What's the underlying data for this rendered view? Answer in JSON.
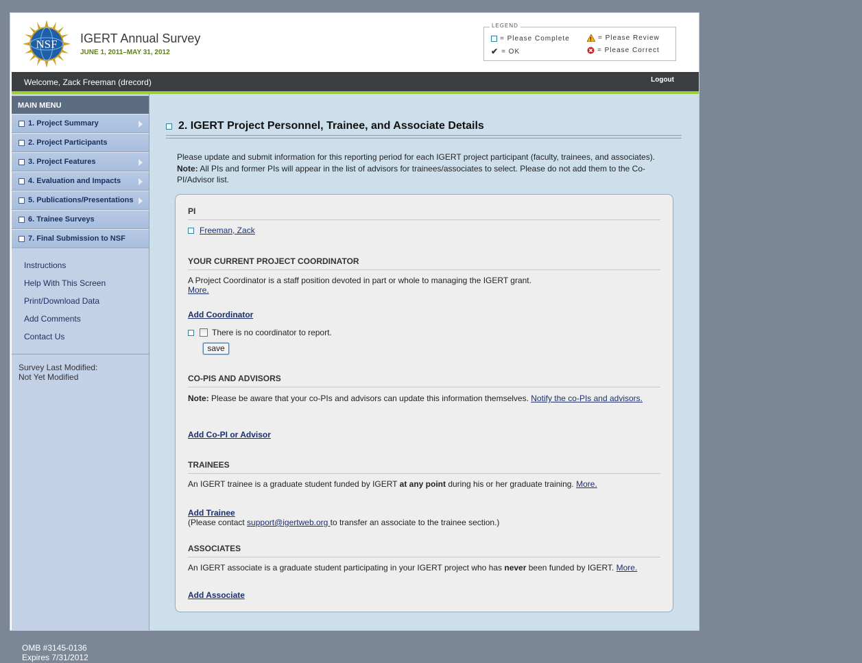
{
  "header": {
    "logo_text": "NSF",
    "title": "IGERT Annual Survey",
    "dates": "JUNE 1, 2011–MAY 31, 2012"
  },
  "legend": {
    "title": "LEGEND",
    "complete": "= Please Complete",
    "review": "= Please Review",
    "ok": "= OK",
    "correct": "= Please Correct"
  },
  "welcome_bar": {
    "welcome": "Welcome, Zack Freeman (drecord)",
    "logout": "Logout"
  },
  "sidebar": {
    "title": "MAIN MENU",
    "items": [
      {
        "label": "1. Project Summary",
        "has_arrow": true
      },
      {
        "label": "2. Project Participants",
        "has_arrow": false
      },
      {
        "label": "3. Project Features",
        "has_arrow": true
      },
      {
        "label": "4. Evaluation and Impacts",
        "has_arrow": true
      },
      {
        "label": "5. Publications/Presentations",
        "has_arrow": true
      },
      {
        "label": "6. Trainee Surveys",
        "has_arrow": false
      },
      {
        "label": "7. Final Submission to NSF",
        "has_arrow": false
      }
    ],
    "links": [
      "Instructions",
      "Help With This Screen",
      "Print/Download Data",
      "Add Comments",
      "Contact Us"
    ],
    "modified_label": "Survey Last Modified:",
    "modified_value": "Not Yet Modified"
  },
  "main": {
    "title": "2. IGERT Project Personnel, Trainee, and Associate Details",
    "intro": "Please update and submit information for this reporting period for each IGERT project participant (faculty, trainees, and associates).",
    "note_label": "Note:",
    "note_text": " All PIs and former PIs will appear in the list of advisors for trainees/associates to select. Please do not add them to the Co-PI/Advisor list."
  },
  "panel": {
    "pi_heading": "PI",
    "pi_name": "Freeman, Zack",
    "coord_heading": "YOUR CURRENT PROJECT COORDINATOR",
    "coord_desc": "A Project Coordinator is a staff position devoted in part or whole to managing the IGERT grant.",
    "coord_more": "More.",
    "add_coordinator": "Add Coordinator",
    "no_coordinator": "There is no coordinator to report.",
    "save": "save",
    "copis_heading": "CO-PIS AND ADVISORS",
    "copis_note_label": "Note:",
    "copis_note": " Please be aware that your co-PIs and advisors can update this information themselves. ",
    "copis_notify": "Notify the co-PIs and advisors.",
    "add_copi": "Add Co-PI or Advisor",
    "trainees_heading": "TRAINEES",
    "trainee_desc_1": "An IGERT trainee is a graduate student funded by IGERT ",
    "trainee_desc_bold": "at any point",
    "trainee_desc_2": " during his or her graduate training. ",
    "trainee_more": "More.",
    "add_trainee": "Add Trainee",
    "transfer_1": "(Please contact ",
    "transfer_email": "support@igertweb.org ",
    "transfer_2": "to transfer an associate to the trainee section.)",
    "associates_heading": "ASSOCIATES",
    "assoc_desc_1": "An IGERT associate is a graduate student participating in your IGERT project who has ",
    "assoc_desc_bold": "never",
    "assoc_desc_2": " been funded by IGERT. ",
    "assoc_more": "More.",
    "add_associate": "Add Associate"
  },
  "footer": {
    "omb": "OMB #3145-0136",
    "expires": "Expires 7/31/2012"
  },
  "colors": {
    "background": "#7b8797",
    "welcome_bar": "#3b3e41",
    "accent_green": "#9dcc3b",
    "sidebar": "#c3d1e6",
    "main": "#cddfeb",
    "link": "#1b2f6e"
  }
}
